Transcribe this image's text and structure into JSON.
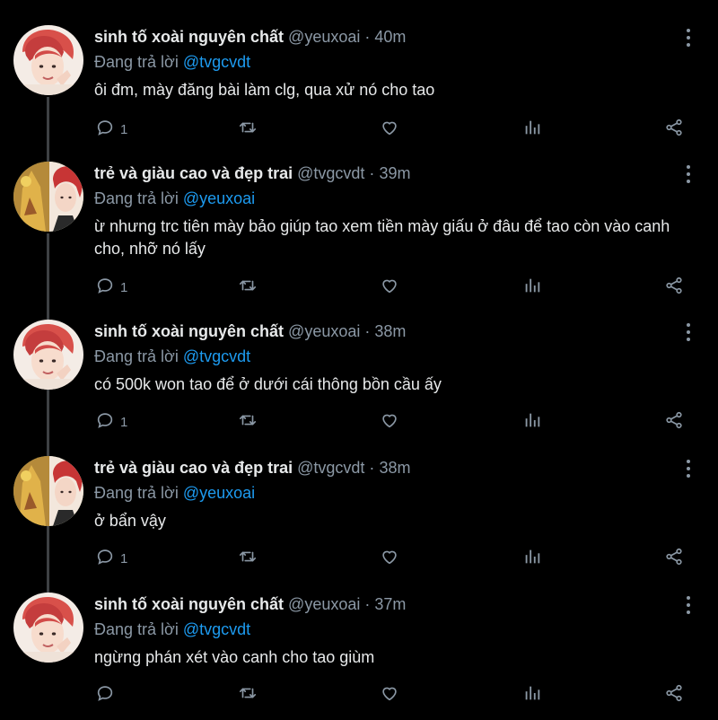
{
  "colors": {
    "background": "#000000",
    "text": "#e7e9ea",
    "muted": "#8b98a5",
    "link": "#1d9bf0",
    "thread_line": "#3e4144"
  },
  "tweets": [
    {
      "avatar": "avatar-red-hair-boy",
      "name": "sinh tố xoài nguyên chất",
      "handle": "@yeuxoai",
      "dot": "·",
      "time": "40m",
      "reply_prefix": "Đang trả lời",
      "reply_to": "@tvgcvdt",
      "text": "ôi đm, mày đăng bài làm clg, qua xử nó cho tao",
      "reply_count": "1"
    },
    {
      "avatar": "avatar-two-people-collage",
      "name": "trẻ và giàu cao và đẹp trai",
      "handle": "@tvgcvdt",
      "dot": "·",
      "time": "39m",
      "reply_prefix": "Đang trả lời",
      "reply_to": "@yeuxoai",
      "text": "ừ nhưng trc tiên mày bảo giúp tao xem tiền mày giấu ở đâu để tao còn vào canh cho, nhỡ nó lấy",
      "reply_count": "1"
    },
    {
      "avatar": "avatar-red-hair-boy",
      "name": "sinh tố xoài nguyên chất",
      "handle": "@yeuxoai",
      "dot": "·",
      "time": "38m",
      "reply_prefix": "Đang trả lời",
      "reply_to": "@tvgcvdt",
      "text": "có 500k won tao để ở dưới cái thông bồn cầu ấy",
      "reply_count": "1"
    },
    {
      "avatar": "avatar-two-people-collage",
      "name": "trẻ và giàu cao và đẹp trai",
      "handle": "@tvgcvdt",
      "dot": "·",
      "time": "38m",
      "reply_prefix": "Đang trả lời",
      "reply_to": "@yeuxoai",
      "text": "ở bẩn vậy",
      "reply_count": "1"
    },
    {
      "avatar": "avatar-red-hair-boy",
      "name": "sinh tố xoài nguyên chất",
      "handle": "@yeuxoai",
      "dot": "·",
      "time": "37m",
      "reply_prefix": "Đang trả lời",
      "reply_to": "@tvgcvdt",
      "text": "ngừng phán xét vào canh cho tao giùm",
      "reply_count": ""
    }
  ],
  "icons": {
    "reply": "reply-icon",
    "retweet": "retweet-icon",
    "like": "like-icon",
    "views": "views-icon",
    "share": "share-icon",
    "more": "more-icon"
  }
}
